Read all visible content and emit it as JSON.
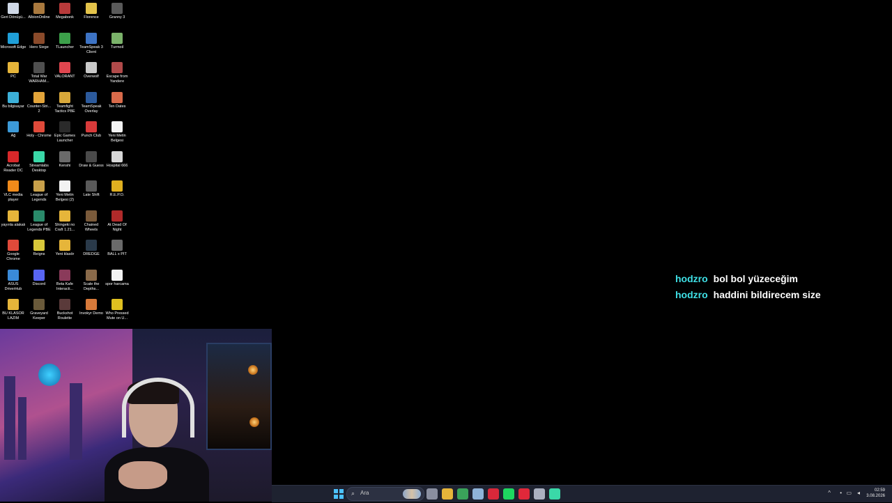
{
  "desktop": {
    "icons": [
      {
        "label": "Geri Dönüşü...",
        "color": "#cfd8e6"
      },
      {
        "label": "AlbionOnline",
        "color": "#a9793e"
      },
      {
        "label": "Megabonk",
        "color": "#b83a3a"
      },
      {
        "label": "Florence",
        "color": "#e3c34a"
      },
      {
        "label": "Granny 3",
        "color": "#5a5a5a"
      },
      {
        "label": "Microsoft Edge",
        "color": "#1f9fd8"
      },
      {
        "label": "Hero Siege",
        "color": "#8a4a2a"
      },
      {
        "label": "TLauncher",
        "color": "#3ca04a"
      },
      {
        "label": "TeamSpeak 3 Client",
        "color": "#3d73c4"
      },
      {
        "label": "Turmoil",
        "color": "#7bb36a"
      },
      {
        "label": "PC",
        "color": "#e6b53a"
      },
      {
        "label": "Total War WARHAM...",
        "color": "#4f4f4f"
      },
      {
        "label": "VALORANT",
        "color": "#e0464f"
      },
      {
        "label": "Overwolf",
        "color": "#c9c9c9"
      },
      {
        "label": "Escape from Yandere",
        "color": "#b04a4a"
      },
      {
        "label": "Bu bilgisayar",
        "color": "#3cb0d8"
      },
      {
        "label": "Counter-Stri... 2",
        "color": "#e3a43a"
      },
      {
        "label": "Teamfight Tactics PBE",
        "color": "#d8a83a"
      },
      {
        "label": "TeamSpeak Overlay",
        "color": "#2c5a9c"
      },
      {
        "label": "Ten Dates",
        "color": "#d86a4a"
      },
      {
        "label": "Ağ",
        "color": "#3c9ad8"
      },
      {
        "label": "Holy - Chrome",
        "color": "#e04a3a"
      },
      {
        "label": "Epic Games Launcher",
        "color": "#2a2a2a"
      },
      {
        "label": "Punch Club",
        "color": "#d83a3a"
      },
      {
        "label": "Yeni Metin Belgesi",
        "color": "#f2f2f2"
      },
      {
        "label": "Acrobat Reader DC",
        "color": "#d8282a"
      },
      {
        "label": "Streamlabs Desktop",
        "color": "#3ad8a8"
      },
      {
        "label": "Kenshi",
        "color": "#6a6a6a"
      },
      {
        "label": "Draw & Guess",
        "color": "#4a4a4a"
      },
      {
        "label": "Hospital 666",
        "color": "#d8d8d8"
      },
      {
        "label": "VLC media player",
        "color": "#f08a1a"
      },
      {
        "label": "League of Legends",
        "color": "#c8a04a"
      },
      {
        "label": "Yeni Metin Belgesi (2)",
        "color": "#f2f2f2"
      },
      {
        "label": "Late Shift",
        "color": "#5a5a5a"
      },
      {
        "label": "R.E.P.O.",
        "color": "#e0b020"
      },
      {
        "label": "yayınla alakalı",
        "color": "#e6b53a"
      },
      {
        "label": "League of Legends PBE",
        "color": "#2a8a6a"
      },
      {
        "label": "Shingeki no Craft 1.21...",
        "color": "#e6b53a"
      },
      {
        "label": "Chained Wheels",
        "color": "#7a5a3a"
      },
      {
        "label": "At Dead Of Night",
        "color": "#b02a2a"
      },
      {
        "label": "Google Chrome",
        "color": "#e04a3a"
      },
      {
        "label": "Reigns",
        "color": "#d8c83a"
      },
      {
        "label": "Yeni klasör",
        "color": "#e6b53a"
      },
      {
        "label": "DREDGE",
        "color": "#2a3a4a"
      },
      {
        "label": "BALL x PIT",
        "color": "#6a6a6a"
      },
      {
        "label": "ASUS DriverHub",
        "color": "#3a8ad8"
      },
      {
        "label": "Discord",
        "color": "#5865f2"
      },
      {
        "label": "Beta Kafe Interacti...",
        "color": "#8a3a5a"
      },
      {
        "label": "Scale the Depths...",
        "color": "#8a6a4a"
      },
      {
        "label": "spor harcama",
        "color": "#f2f2f2"
      },
      {
        "label": "BU KLASÖR LAZIM",
        "color": "#e6b53a"
      },
      {
        "label": "Graveyard Keeper",
        "color": "#6a5a3a"
      },
      {
        "label": "Buckshot Roulette",
        "color": "#5a3a3a"
      },
      {
        "label": "Invokyr Demo",
        "color": "#d87a3a"
      },
      {
        "label": "Who Pressed Mute on U...",
        "color": "#e0c020"
      }
    ]
  },
  "chat": {
    "messages": [
      {
        "user": "hodzro",
        "text": "bol bol yüzeceğim"
      },
      {
        "user": "hodzro",
        "text": "haddini bildirecem size"
      }
    ]
  },
  "taskbar": {
    "search_placeholder": "Ara",
    "clock_time": "02:59",
    "clock_date": "3.08.2026",
    "pinned": [
      {
        "name": "file-manager",
        "color": "#8a8fa0"
      },
      {
        "name": "file-explorer",
        "color": "#e6b53a"
      },
      {
        "name": "chrome",
        "color": "#3aa35a"
      },
      {
        "name": "steam",
        "color": "#8fb3d8"
      },
      {
        "name": "opera",
        "color": "#d8283a"
      },
      {
        "name": "spotify",
        "color": "#1ed760"
      },
      {
        "name": "red-app",
        "color": "#e0283a"
      },
      {
        "name": "settings",
        "color": "#aab0c0"
      },
      {
        "name": "streamlabs",
        "color": "#3ad8a8"
      }
    ]
  }
}
